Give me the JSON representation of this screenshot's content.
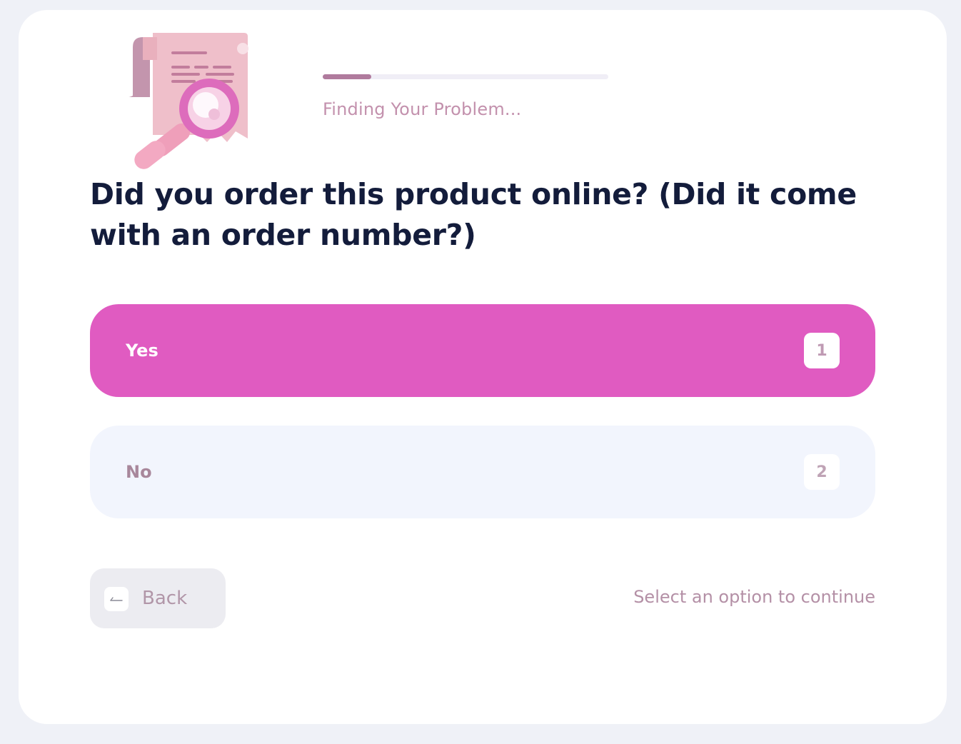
{
  "progress": {
    "fraction": 0.17,
    "status_text": "Finding Your Problem..."
  },
  "illustration": {
    "icon": "receipt-magnifier-icon"
  },
  "question": {
    "text": "Did you order this product online? (Did it come with an order number?)"
  },
  "options": [
    {
      "label": "Yes",
      "key": "1",
      "state": "selected"
    },
    {
      "label": "No",
      "key": "2",
      "state": "unselected"
    }
  ],
  "footer": {
    "back_label": "Back",
    "hint": "Select an option to continue"
  },
  "colors": {
    "selected_option": "#e05bc1",
    "unselected_option": "#f2f5fd",
    "heading": "#131c3b",
    "muted_pink": "#c391ad",
    "progress_fill": "#b07b9d"
  }
}
